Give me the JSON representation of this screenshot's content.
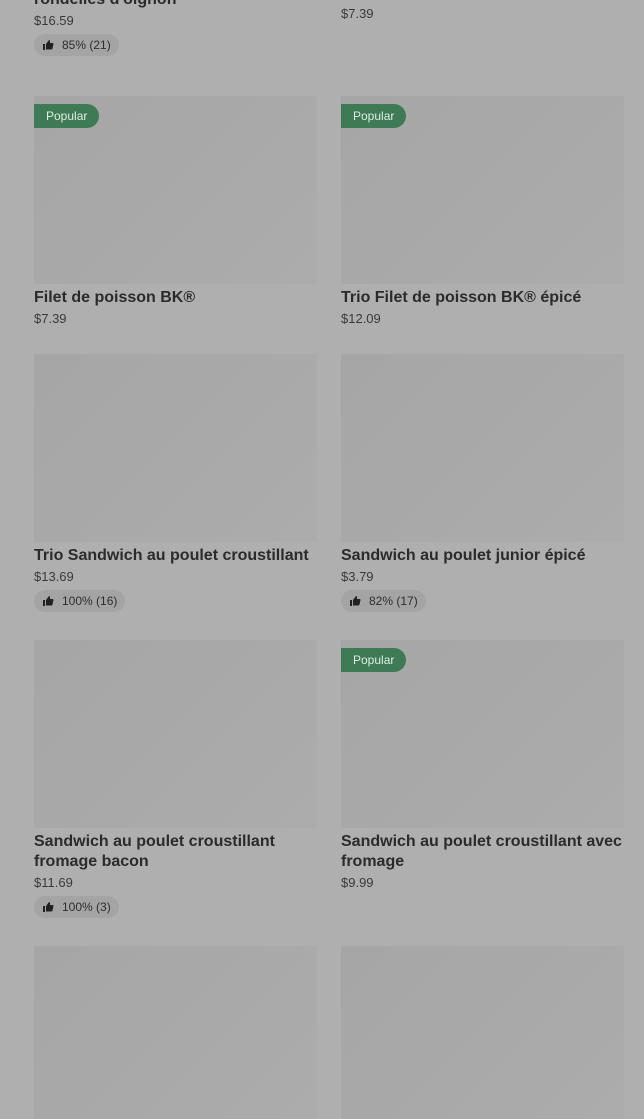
{
  "top_row": [
    {
      "name_line1": "",
      "name_line2": "rondelles d'oignon",
      "price": "$16.59",
      "rating": "85% (21)"
    },
    {
      "name_line1": "",
      "name_line2": "",
      "price": "$7.39",
      "rating": null
    }
  ],
  "items": [
    {
      "name": "Filet de poisson BK®",
      "price": "$7.39",
      "popular": "Popular",
      "rating": null
    },
    {
      "name": "Trio Filet de poisson BK® épicé",
      "price": "$12.09",
      "popular": "Popular",
      "rating": null
    },
    {
      "name": "Trio Sandwich au poulet croustillant",
      "price": "$13.69",
      "popular": null,
      "rating": "100% (16)"
    },
    {
      "name": "Sandwich au poulet junior épicé",
      "price": "$3.79",
      "popular": null,
      "rating": "82% (17)"
    },
    {
      "name": "Sandwich au poulet croustillant fromage bacon",
      "price": "$11.69",
      "popular": null,
      "rating": "100% (3)"
    },
    {
      "name": "Sandwich au poulet croustillant avec fromage",
      "price": "$9.99",
      "popular": "Popular",
      "rating": null
    }
  ],
  "icons": {
    "rating": "thumbs-up-icon"
  }
}
